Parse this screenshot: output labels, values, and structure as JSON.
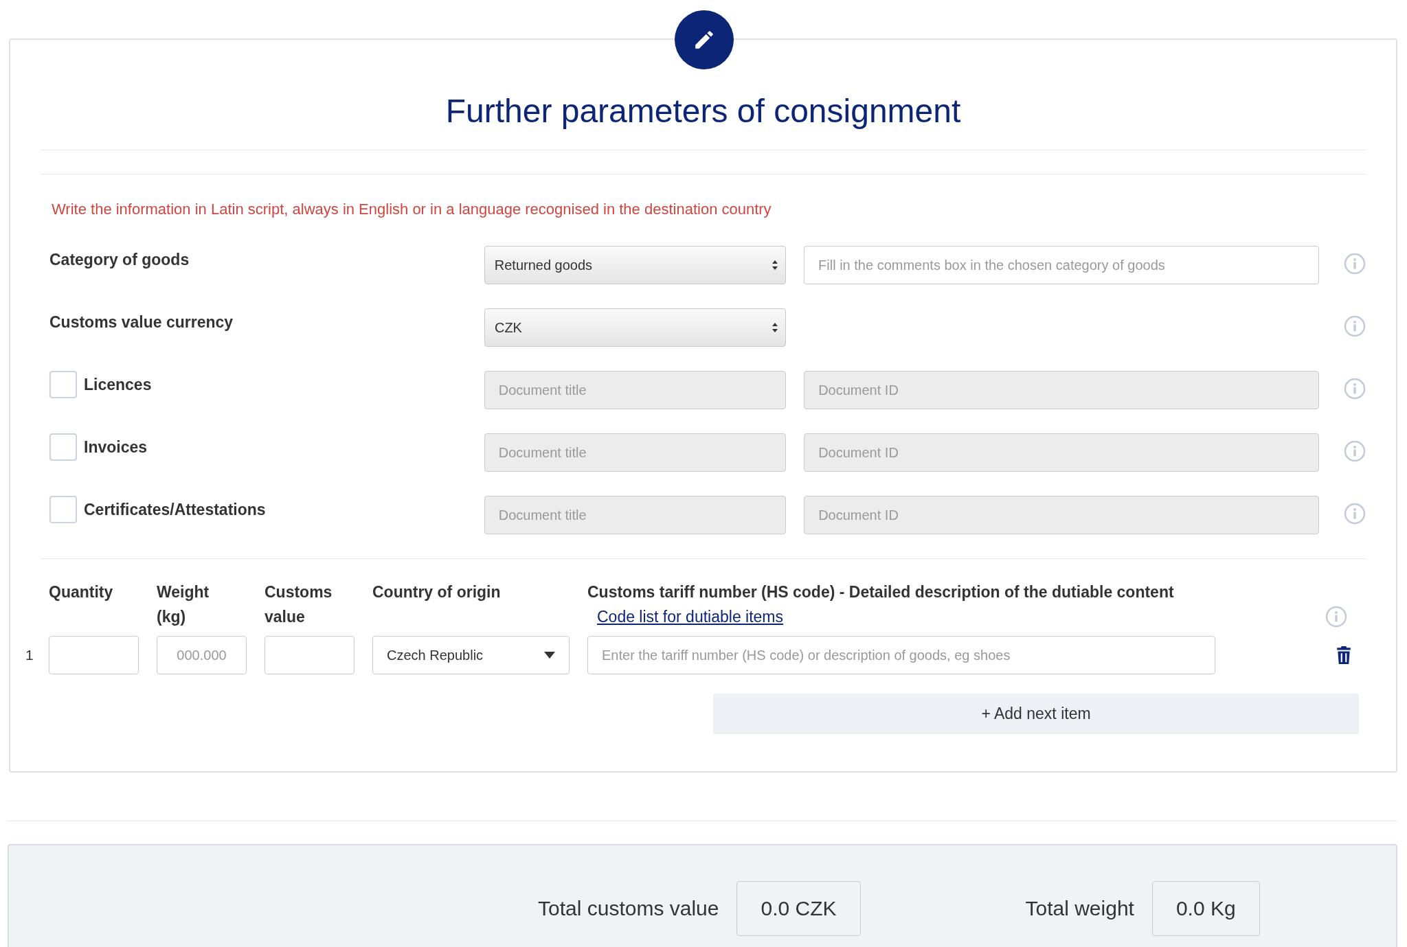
{
  "header": {
    "title": "Further parameters of consignment"
  },
  "notice": "Write the information in Latin script, always in English or in a language recognised in the destination country",
  "fields": [
    {
      "kind": "select",
      "label": "Category of goods",
      "value": "Returned goods",
      "comment_placeholder": "Fill in the comments box in the chosen category of goods"
    },
    {
      "kind": "select",
      "label": "Customs value currency",
      "value": "CZK"
    },
    {
      "kind": "document",
      "label": "Licences",
      "checked": false,
      "title_placeholder": "Document title",
      "id_placeholder": "Document ID"
    },
    {
      "kind": "document",
      "label": "Invoices",
      "checked": false,
      "title_placeholder": "Document title",
      "id_placeholder": "Document ID"
    },
    {
      "kind": "document",
      "label": "Certificates/Attestations",
      "checked": false,
      "title_placeholder": "Document title",
      "id_placeholder": "Document ID"
    }
  ],
  "items": {
    "columns": [
      "Quantity",
      "Weight (kg)",
      "Customs value",
      "Country of origin",
      "Customs tariff number (HS code) - Detailed description of the dutiable content"
    ],
    "code_list_link": "Code list for dutiable items",
    "rows": [
      {
        "number": "1",
        "weight_placeholder": "000.000",
        "country": "Czech Republic",
        "description_placeholder": "Enter the tariff number (HS code) or description of goods, eg shoes"
      }
    ],
    "add_button": "+ Add next item"
  },
  "totals": [
    {
      "label": "Total customs value",
      "value": "0.0 CZK"
    },
    {
      "label": "Total weight",
      "value": "0.0 Kg"
    }
  ]
}
